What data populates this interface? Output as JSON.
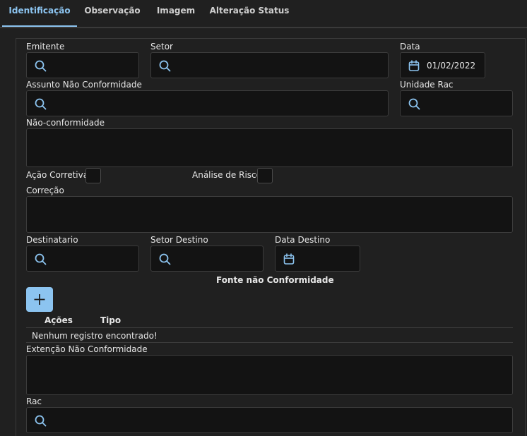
{
  "tabs": [
    {
      "label": "Identificação",
      "active": true
    },
    {
      "label": "Observação",
      "active": false
    },
    {
      "label": "Imagem",
      "active": false
    },
    {
      "label": "Alteração Status",
      "active": false
    }
  ],
  "form": {
    "emitente_label": "Emitente",
    "setor_label": "Setor",
    "data_label": "Data",
    "data_value": "01/02/2022",
    "assunto_label": "Assunto Não Conformidade",
    "unidade_label": "Unidade Rac",
    "nao_conformidade_label": "Não-conformidade",
    "acao_corretiva_label": "Ação Corretiva",
    "analise_risco_label": "Análise de Risco",
    "correcao_label": "Correção",
    "destinatario_label": "Destinatario",
    "setor_destino_label": "Setor Destino",
    "data_destino_label": "Data Destino",
    "fonte_title": "Fonte não Conformidade",
    "extencao_label": "Extenção Não Conformidade",
    "rac_label": "Rac"
  },
  "fonte_table": {
    "columns": [
      "Ações",
      "Tipo"
    ],
    "empty_message": "Nenhum registro encontrado!"
  },
  "colors": {
    "accent": "#8cc4f0",
    "background": "#202020",
    "input": "#131313"
  },
  "icons": {
    "search": "search-icon",
    "calendar": "calendar-icon",
    "add": "plus-icon"
  }
}
